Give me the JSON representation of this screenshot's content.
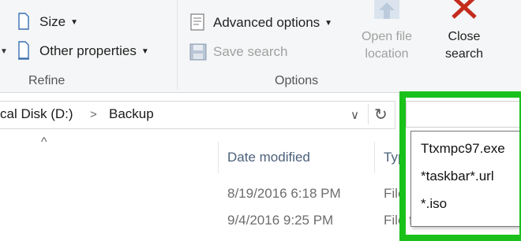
{
  "ribbon": {
    "refine": {
      "size_label": "Size",
      "other_properties_label": "Other properties",
      "group_label": "Refine"
    },
    "options": {
      "advanced_options_label": "Advanced options",
      "save_search_label": "Save search",
      "group_label": "Options"
    },
    "open_file_location": {
      "line1": "Open file",
      "line2": "location"
    },
    "close_search": {
      "line1": "Close",
      "line2": "search"
    }
  },
  "address_bar": {
    "segments": [
      "cal Disk (D:)",
      "Backup"
    ],
    "separator": ">",
    "dropdown_glyph": "∨",
    "refresh_glyph": "↻"
  },
  "file_list": {
    "sort_indicator": "^",
    "columns": [
      "Date modified",
      "Typ"
    ],
    "rows": [
      {
        "date_modified": "8/19/2016 6:18 PM",
        "type": "File"
      },
      {
        "date_modified": "9/4/2016 9:25 PM",
        "type": "File folder"
      }
    ]
  },
  "search": {
    "value": "",
    "suggestions": [
      "Ttxmpc97.exe",
      "*taskbar*.url",
      "*.iso"
    ]
  },
  "colors": {
    "highlight": "#19c11a",
    "close_red": "#c42b1c",
    "header_text": "#4c607a"
  }
}
